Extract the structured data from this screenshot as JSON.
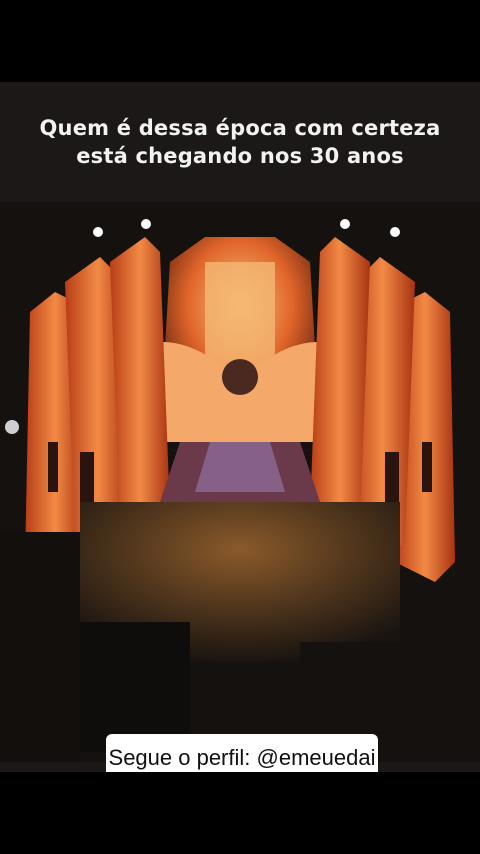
{
  "post": {
    "caption": "Quem é dessa época com certeza está chegando nos 30 anos",
    "follow_label": "Segue o perfil: @emeuedai"
  },
  "photo": {
    "subject": "aerial-concert-stage",
    "stage_color": "#e0652a"
  }
}
